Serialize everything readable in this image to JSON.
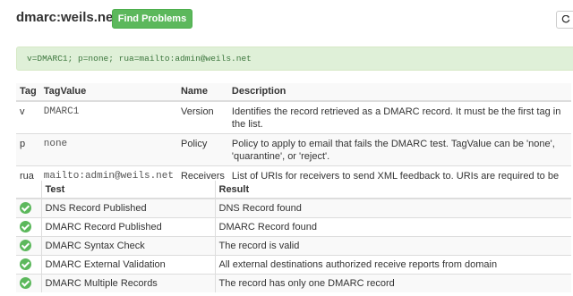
{
  "header": {
    "domain_title": "dmarc:weils.net",
    "find_problems_label": "Find Problems",
    "refresh_icon": "refresh-icon"
  },
  "record": {
    "text": "v=DMARC1; p=none; rua=mailto:admin@weils.net"
  },
  "tag_table": {
    "headers": [
      "Tag",
      "TagValue",
      "Name",
      "Description"
    ],
    "rows": [
      {
        "tag": "v",
        "value": "DMARC1",
        "name": "Version",
        "description": "Identifies the record retrieved as a DMARC record. It must be the first tag in the list."
      },
      {
        "tag": "p",
        "value": "none",
        "name": "Policy",
        "description": "Policy to apply to email that fails the DMARC test. TagValue can be 'none', 'quarantine', or 'reject'."
      },
      {
        "tag": "rua",
        "value": "mailto:admin@weils.net",
        "name": "Receivers",
        "description": "List of URIs for receivers to send XML feedback to. URIs are required to be added in the format of 'mailto:address@example.com'."
      }
    ]
  },
  "test_table": {
    "headers": [
      "",
      "Test",
      "Result"
    ],
    "rows": [
      {
        "status": "pass",
        "icon": "check-circle-icon",
        "test": "DNS Record Published",
        "result": "DNS Record found"
      },
      {
        "status": "pass",
        "icon": "check-circle-icon",
        "test": "DMARC Record Published",
        "result": "DMARC Record found"
      },
      {
        "status": "pass",
        "icon": "check-circle-icon",
        "test": "DMARC Syntax Check",
        "result": "The record is valid"
      },
      {
        "status": "pass",
        "icon": "check-circle-icon",
        "test": "DMARC External Validation",
        "result": "All external destinations authorized receive reports from domain"
      },
      {
        "status": "pass",
        "icon": "check-circle-icon",
        "test": "DMARC Multiple Records",
        "result": "The record has only one DMARC record"
      }
    ]
  },
  "colors": {
    "success": "#5cb85c",
    "record_bg": "#dff0d8",
    "record_text": "#3c763d"
  }
}
